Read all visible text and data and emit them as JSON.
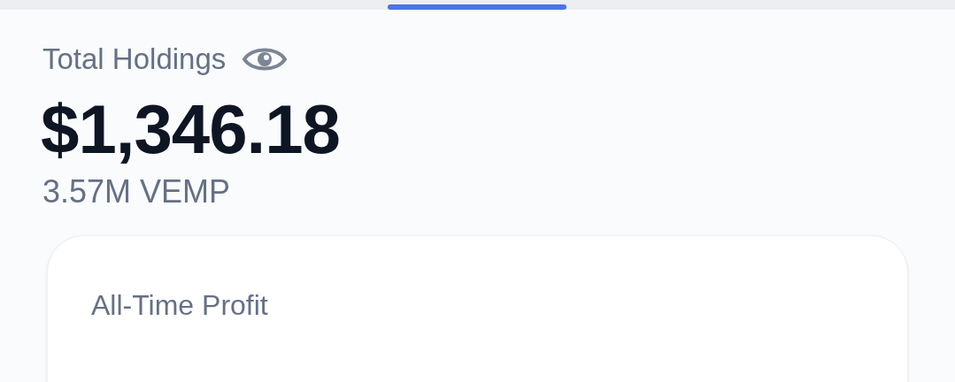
{
  "holdings": {
    "label": "Total Holdings",
    "value": "$1,346.18",
    "token_amount": "3.57M VEMP"
  },
  "profit_card": {
    "label": "All-Time Profit"
  }
}
